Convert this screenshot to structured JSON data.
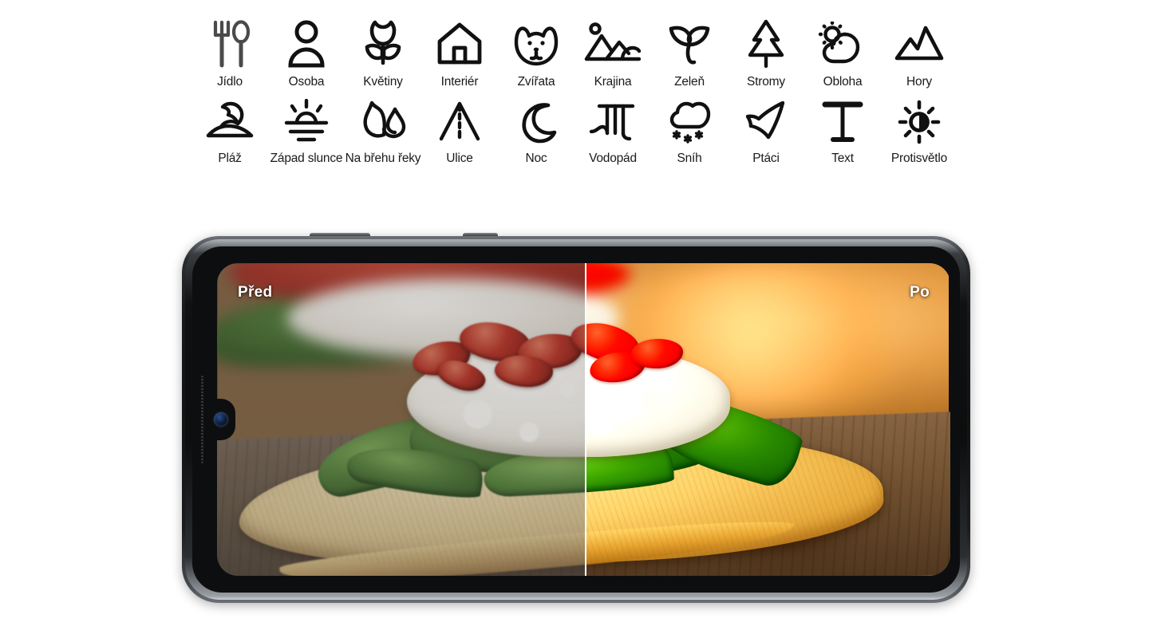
{
  "scene_categories": {
    "row1": [
      {
        "label": "Jídlo",
        "icon": "fork-spoon-icon"
      },
      {
        "label": "Osoba",
        "icon": "person-icon"
      },
      {
        "label": "Květiny",
        "icon": "tulip-flower-icon"
      },
      {
        "label": "Interiér",
        "icon": "house-icon"
      },
      {
        "label": "Zvířata",
        "icon": "dog-face-icon"
      },
      {
        "label": "Krajina",
        "icon": "landscape-icon"
      },
      {
        "label": "Zeleň",
        "icon": "sprout-leaves-icon"
      },
      {
        "label": "Stromy",
        "icon": "pine-tree-icon"
      },
      {
        "label": "Obloha",
        "icon": "sun-cloud-icon"
      },
      {
        "label": "Hory",
        "icon": "mountains-icon"
      }
    ],
    "row2": [
      {
        "label": "Pláž",
        "icon": "beach-umbrella-icon"
      },
      {
        "label": "Západ slunce",
        "icon": "sunset-icon"
      },
      {
        "label": "Na břehu řeky",
        "icon": "riverside-icon"
      },
      {
        "label": "Ulice",
        "icon": "street-road-icon"
      },
      {
        "label": "Noc",
        "icon": "crescent-moon-icon"
      },
      {
        "label": "Vodopád",
        "icon": "waterfall-icon"
      },
      {
        "label": "Sníh",
        "icon": "snow-cloud-icon"
      },
      {
        "label": "Ptáci",
        "icon": "bird-icon"
      },
      {
        "label": "Text",
        "icon": "text-letter-t-icon"
      },
      {
        "label": "Protisvětlo",
        "icon": "backlight-sun-icon"
      }
    ]
  },
  "phone_preview": {
    "before_label": "Před",
    "after_label": "Po",
    "subject": "flatbread with ricotta, spinach and roasted red peppers on a wooden board"
  },
  "colors": {
    "page_background": "#ffffff",
    "icon_stroke": "#111111",
    "food_icon_stroke": "#4a4a4a",
    "label_text": "#1a1a1a",
    "overlay_label_text": "#ffffff",
    "divider": "#ffffff",
    "phone_frame": "#17181a"
  }
}
